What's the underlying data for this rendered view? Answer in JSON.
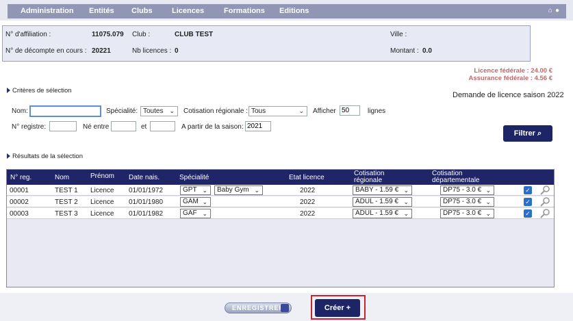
{
  "nav": {
    "items": [
      "Administration",
      "Entités",
      "Clubs",
      "Licences",
      "Formations",
      "Editions"
    ],
    "icons": [
      "home-icon",
      "lock-icon"
    ]
  },
  "info": {
    "affiliation_label": "N° d'affiliation :",
    "affiliation_value": "11075.079",
    "club_label": "Club :",
    "club_value": "CLUB TEST",
    "ville_label": "Ville :",
    "decompte_label": "N° de décompte en cours :",
    "decompte_value": "20221",
    "nb_licences_label": "Nb licences :",
    "nb_licences_value": "0",
    "montant_label": "Montant :",
    "montant_value": "0.0"
  },
  "fees": {
    "licence": "Licence fédérale : 24.00 €",
    "assurance": "Assurance fédérale : 4.56 €"
  },
  "criteria": {
    "title": "Critères de sélection",
    "season_title": "Demande de licence saison 2022",
    "nom_label": "Nom:",
    "nom_value": "",
    "specialite_label": "Spécialité:",
    "specialite_value": "Toutes",
    "cotisation_label": "Cotisation régionale :",
    "cotisation_value": "Tous",
    "afficher_label": "Afficher",
    "afficher_value": "50",
    "lignes_label": "lignes",
    "registre_label": "N° registre:",
    "registre_value": "",
    "ne_entre_label": "Né entre",
    "ne_entre_value": "",
    "et_label": "et",
    "et_value": "",
    "saison_label": "A partir de la saison:",
    "saison_value": "2021",
    "filter_button": "Filtrer"
  },
  "results": {
    "title": "Résultats de la sélection",
    "headers": [
      "N° reg.",
      "Nom",
      "Prénom",
      "Date nais.",
      "Spécialité",
      "Etat licence",
      "Cotisation régionale",
      "Cotisation départementale"
    ],
    "rows": [
      {
        "reg": "00001",
        "nom": "TEST 1",
        "prenom": "Licence",
        "date": "01/01/1972",
        "spec": "GPT",
        "spec2": "Baby Gym",
        "etat": "2022",
        "cot_reg": "BABY - 1.59 €",
        "cot_dep": "DP75 - 3.0 €"
      },
      {
        "reg": "00002",
        "nom": "TEST 2",
        "prenom": "Licence",
        "date": "01/01/1980",
        "spec": "GAM",
        "spec2": "",
        "etat": "2022",
        "cot_reg": "ADUL - 1.59 €",
        "cot_dep": "DP75 - 3.0 €"
      },
      {
        "reg": "00003",
        "nom": "TEST 3",
        "prenom": "Licence",
        "date": "01/01/1982",
        "spec": "GAF",
        "spec2": "",
        "etat": "2022",
        "cot_reg": "ADUL - 1.59 €",
        "cot_dep": "DP75 - 3.0 €"
      }
    ]
  },
  "footer": {
    "save_button": "ENREGISTRER",
    "create_button": "Créer +"
  }
}
